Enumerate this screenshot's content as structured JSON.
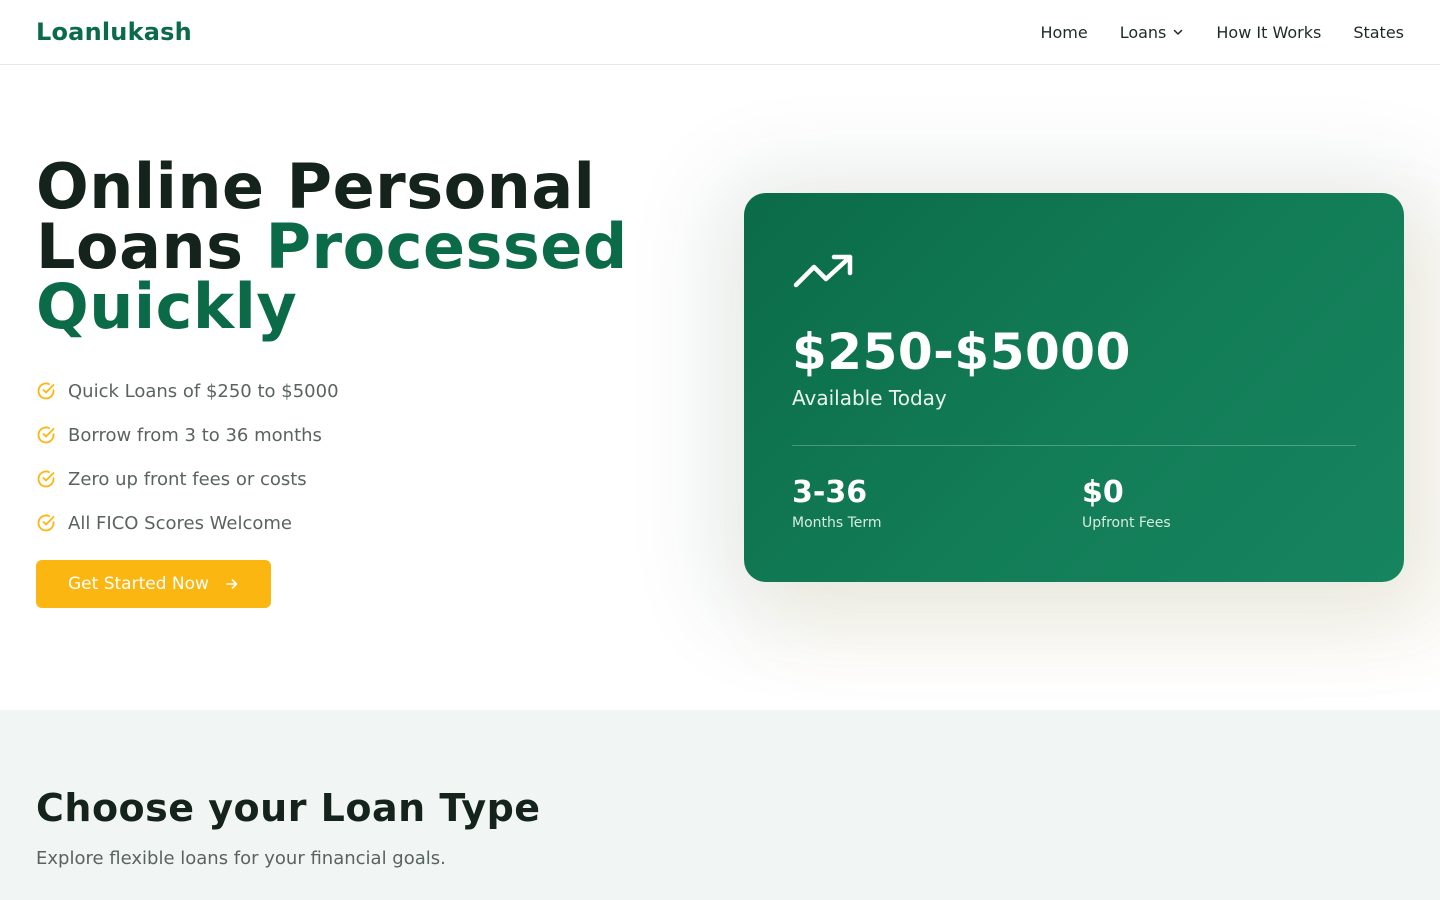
{
  "header": {
    "logo": "Loanlukash",
    "nav": [
      {
        "label": "Home"
      },
      {
        "label": "Loans"
      },
      {
        "label": "How It Works"
      },
      {
        "label": "States"
      }
    ]
  },
  "hero": {
    "title_line1": "Online Personal",
    "title_line2_plain": "Loans",
    "title_line2_accent": "Processed",
    "title_line3_accent": "Quickly",
    "features": [
      "Quick Loans of $250 to $5000",
      "Borrow from 3 to 36 months",
      "Zero up front fees or costs",
      "All FICO Scores Welcome"
    ],
    "cta_label": "Get Started Now"
  },
  "card": {
    "amount": "$250-$5000",
    "subtitle": "Available Today",
    "stats": [
      {
        "value": "3-36",
        "label": "Months Term"
      },
      {
        "value": "$0",
        "label": "Upfront Fees"
      }
    ]
  },
  "loan_types": {
    "title": "Choose your Loan Type",
    "subtitle": "Explore flexible loans for your financial goals."
  },
  "colors": {
    "brand_green": "#0b6b48",
    "accent_yellow": "#fbb611",
    "text_dark": "#14231c",
    "text_muted": "#5a6360",
    "section_bg": "#f1f5f4"
  },
  "icons": {
    "feature": "check-circle-icon",
    "cta": "arrow-right-icon",
    "card": "trending-up-icon",
    "dropdown": "chevron-down-icon"
  }
}
